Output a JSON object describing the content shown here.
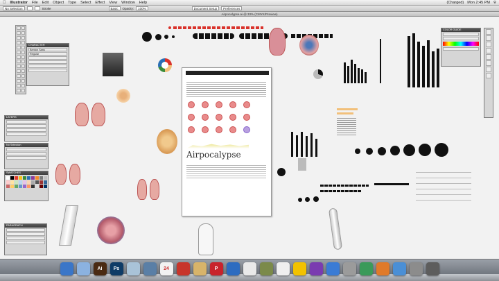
{
  "menubar": {
    "apple": "",
    "app_name": "Illustrator",
    "menus": [
      "File",
      "Edit",
      "Object",
      "Type",
      "Select",
      "Effect",
      "View",
      "Window",
      "Help"
    ],
    "clock": "Mon 2:45 PM",
    "battery": "(Charged)"
  },
  "control_bar": {
    "selection": "No Selection",
    "stroke_label": "Stroke",
    "basic": "Basic",
    "opacity_label": "Opacity:",
    "opacity_value": "100%",
    "doc_setup": "Document Setup",
    "preferences": "Preferences"
  },
  "document": {
    "title": "Airpocalypse.ai @ 33% (CMYK/Preview)"
  },
  "panels": {
    "character": "CHARACTER",
    "character_font": "Benton Sans",
    "character_style": "Regular",
    "layers": "LAYERS",
    "swatches": "SWATCHES",
    "brushes": "No Selection",
    "paragraph": "PARAGRAPH",
    "right_panel": "COLOR GUIDE"
  },
  "artboard": {
    "title": "Airpocalypse"
  },
  "swatch_colors": [
    "#ffffff",
    "#000000",
    "#e23b2c",
    "#f7c21a",
    "#3a8b3a",
    "#2a6fb5",
    "#8a3b9a",
    "#f28a2a",
    "#7a7a7a",
    "#c0c0c0",
    "#ffcccc",
    "#ffe3a3",
    "#cbe7c0",
    "#b9d6f2",
    "#e6c3ea",
    "#f9d5b3",
    "#aaaaaa",
    "#555555",
    "#993333",
    "#336699",
    "#cc6666",
    "#ffcc66",
    "#66aa66",
    "#6699cc",
    "#9966cc",
    "#ff9966",
    "#333333",
    "#dddddd",
    "#660000",
    "#003366"
  ],
  "dock_apps": [
    {
      "label": "",
      "color": "#3a76c8"
    },
    {
      "label": "",
      "color": "#8bb2e0"
    },
    {
      "label": "Ai",
      "color": "#4a2a12"
    },
    {
      "label": "Ps",
      "color": "#0e3b66"
    },
    {
      "label": "",
      "color": "#a9c3d8"
    },
    {
      "label": "",
      "color": "#5a7fa6"
    },
    {
      "label": "24",
      "color": "#f2f2f2"
    },
    {
      "label": "",
      "color": "#c8352b"
    },
    {
      "label": "",
      "color": "#d8b46a"
    },
    {
      "label": "P",
      "color": "#c8232c"
    },
    {
      "label": "",
      "color": "#2d6cc0"
    },
    {
      "label": "",
      "color": "#e9e9e9"
    },
    {
      "label": "",
      "color": "#7b8a4a"
    },
    {
      "label": "",
      "color": "#efefef"
    },
    {
      "label": "",
      "color": "#f2c200"
    },
    {
      "label": "",
      "color": "#7a3bb0"
    },
    {
      "label": "",
      "color": "#3a7bd5"
    },
    {
      "label": "",
      "color": "#9b9b9b"
    },
    {
      "label": "",
      "color": "#3a9a5a"
    },
    {
      "label": "",
      "color": "#e07a2a"
    },
    {
      "label": "",
      "color": "#4a8fd6"
    },
    {
      "label": "",
      "color": "#8c8c8c"
    },
    {
      "label": "",
      "color": "#5d5d5d"
    }
  ],
  "colors": {
    "accent_red": "#d9322b",
    "dock_top": "#9aa0a8"
  }
}
